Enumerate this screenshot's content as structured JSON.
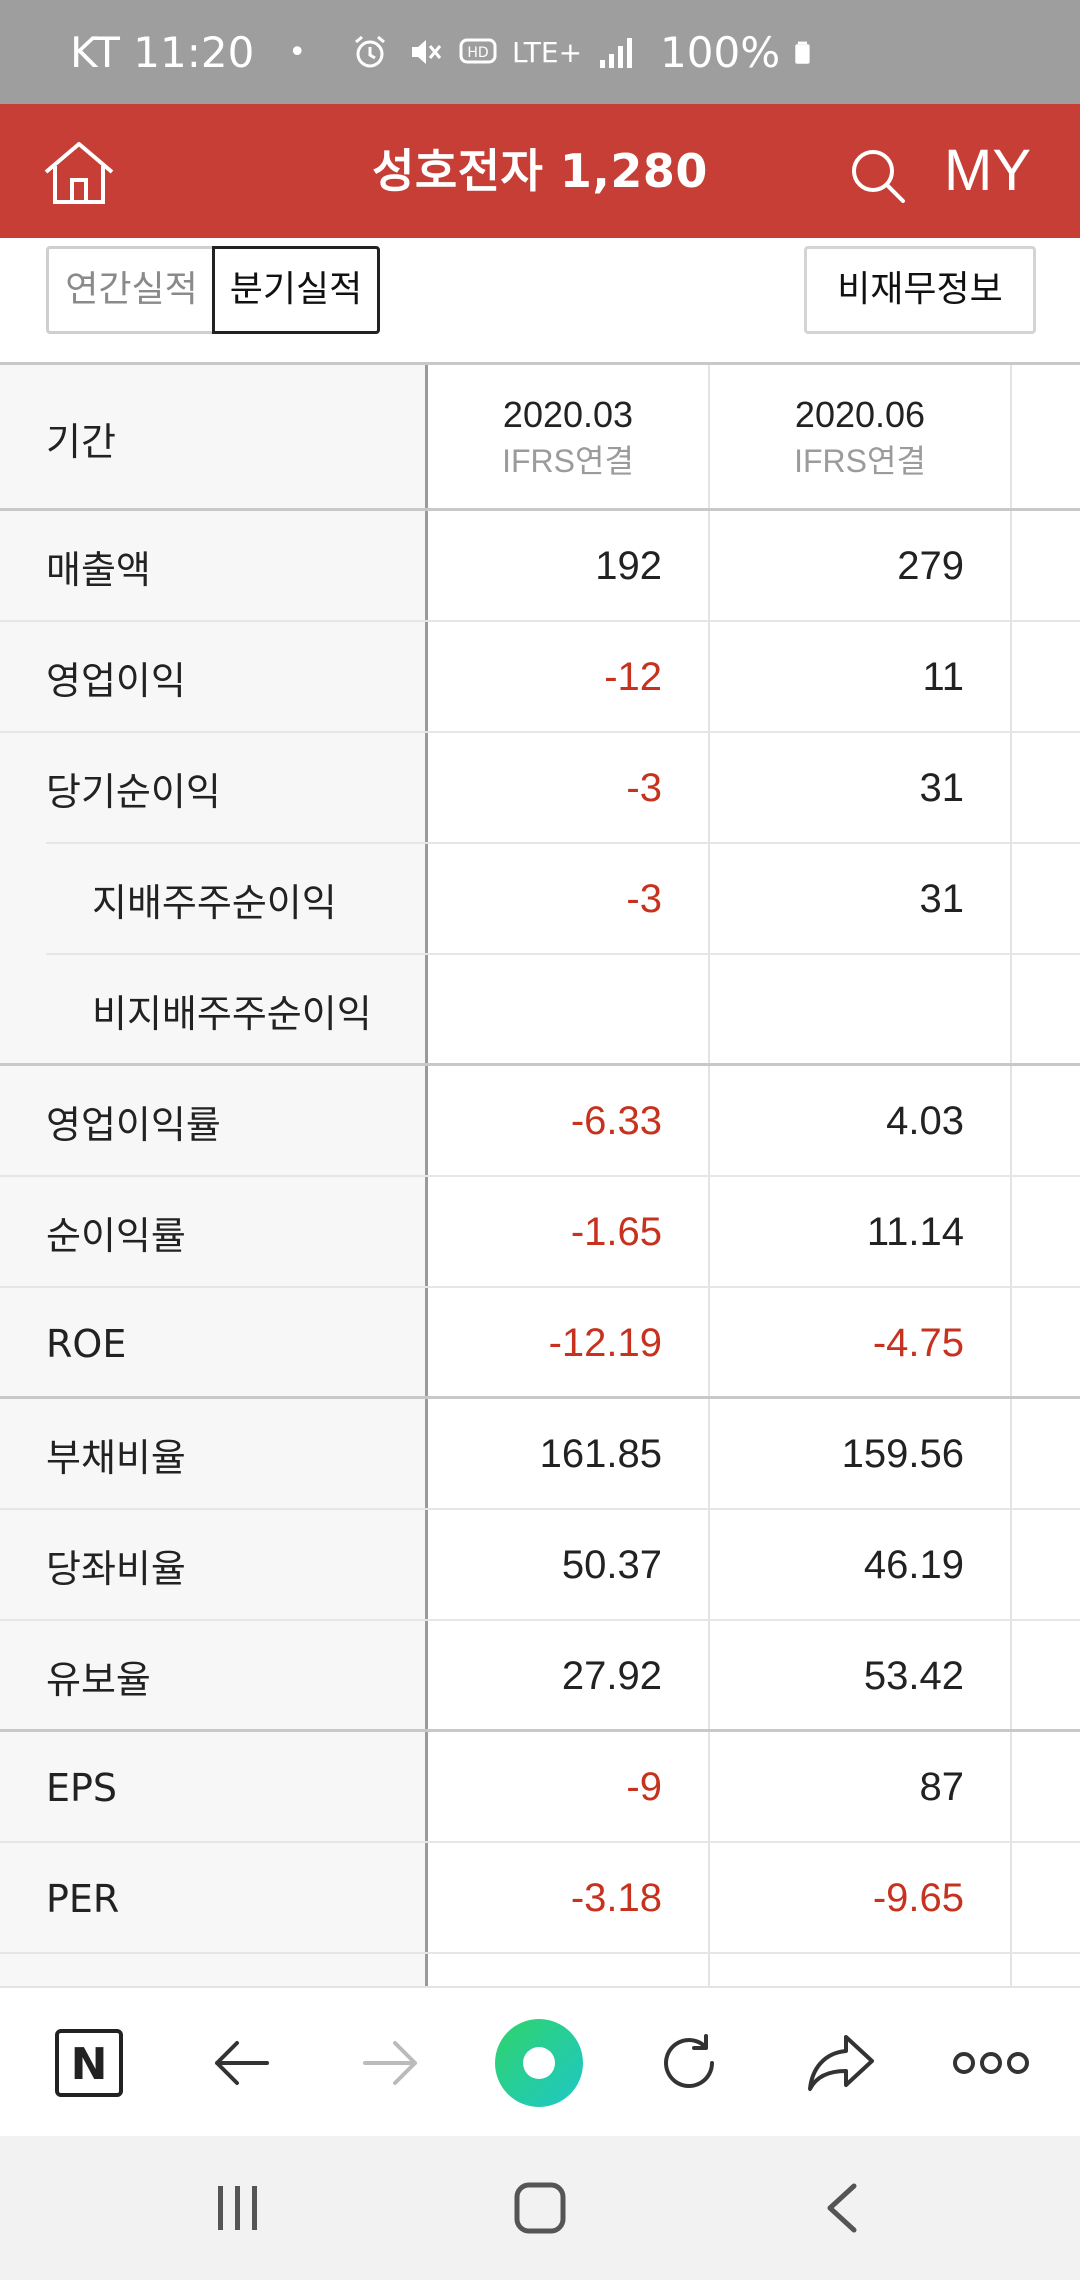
{
  "status_bar": {
    "carrier_time": "KT 11:20",
    "dot": "•",
    "network": "LTE+",
    "battery": "100%"
  },
  "header": {
    "title": "성호전자 1,280",
    "my_label": "MY",
    "bg_color": "#c63e35"
  },
  "tabs": {
    "annual": "연간실적",
    "quarterly": "분기실적",
    "nonfinancial": "비재무정보",
    "active": "quarterly"
  },
  "table": {
    "header": {
      "label": "기간",
      "columns": [
        {
          "date": "2020.03",
          "type": "IFRS연결"
        },
        {
          "date": "2020.06",
          "type": "IFRS연결"
        }
      ]
    },
    "rows": [
      {
        "label": "매출액",
        "v1": "192",
        "v2": "279"
      },
      {
        "label": "영업이익",
        "v1": "-12",
        "v2": "11"
      },
      {
        "label": "당기순이익",
        "v1": "-3",
        "v2": "31"
      },
      {
        "label": "지배주주순이익",
        "v1": "-3",
        "v2": "31"
      },
      {
        "label": "비지배주주순이익",
        "v1": "",
        "v2": ""
      },
      {
        "label": "영업이익률",
        "v1": "-6.33",
        "v2": "4.03"
      },
      {
        "label": "순이익률",
        "v1": "-1.65",
        "v2": "11.14"
      },
      {
        "label": "ROE",
        "v1": "-12.19",
        "v2": "-4.75"
      },
      {
        "label": "부채비율",
        "v1": "161.85",
        "v2": "159.56"
      },
      {
        "label": "당좌비율",
        "v1": "50.37",
        "v2": "46.19"
      },
      {
        "label": "유보율",
        "v1": "27.92",
        "v2": "53.42"
      },
      {
        "label": "EPS",
        "v1": "-9",
        "v2": "87"
      },
      {
        "label": "PER",
        "v1": "-3.18",
        "v2": "-9.65"
      }
    ],
    "negative_color": "#c7321f"
  },
  "toolbar": {
    "naver_icon": "naver-n-icon",
    "back_icon": "arrow-left-icon",
    "forward_icon": "arrow-right-icon",
    "green_icon": "green-dot-icon",
    "refresh_icon": "refresh-icon",
    "share_icon": "share-icon",
    "more_icon": "more-icon",
    "naver_letter": "N"
  }
}
